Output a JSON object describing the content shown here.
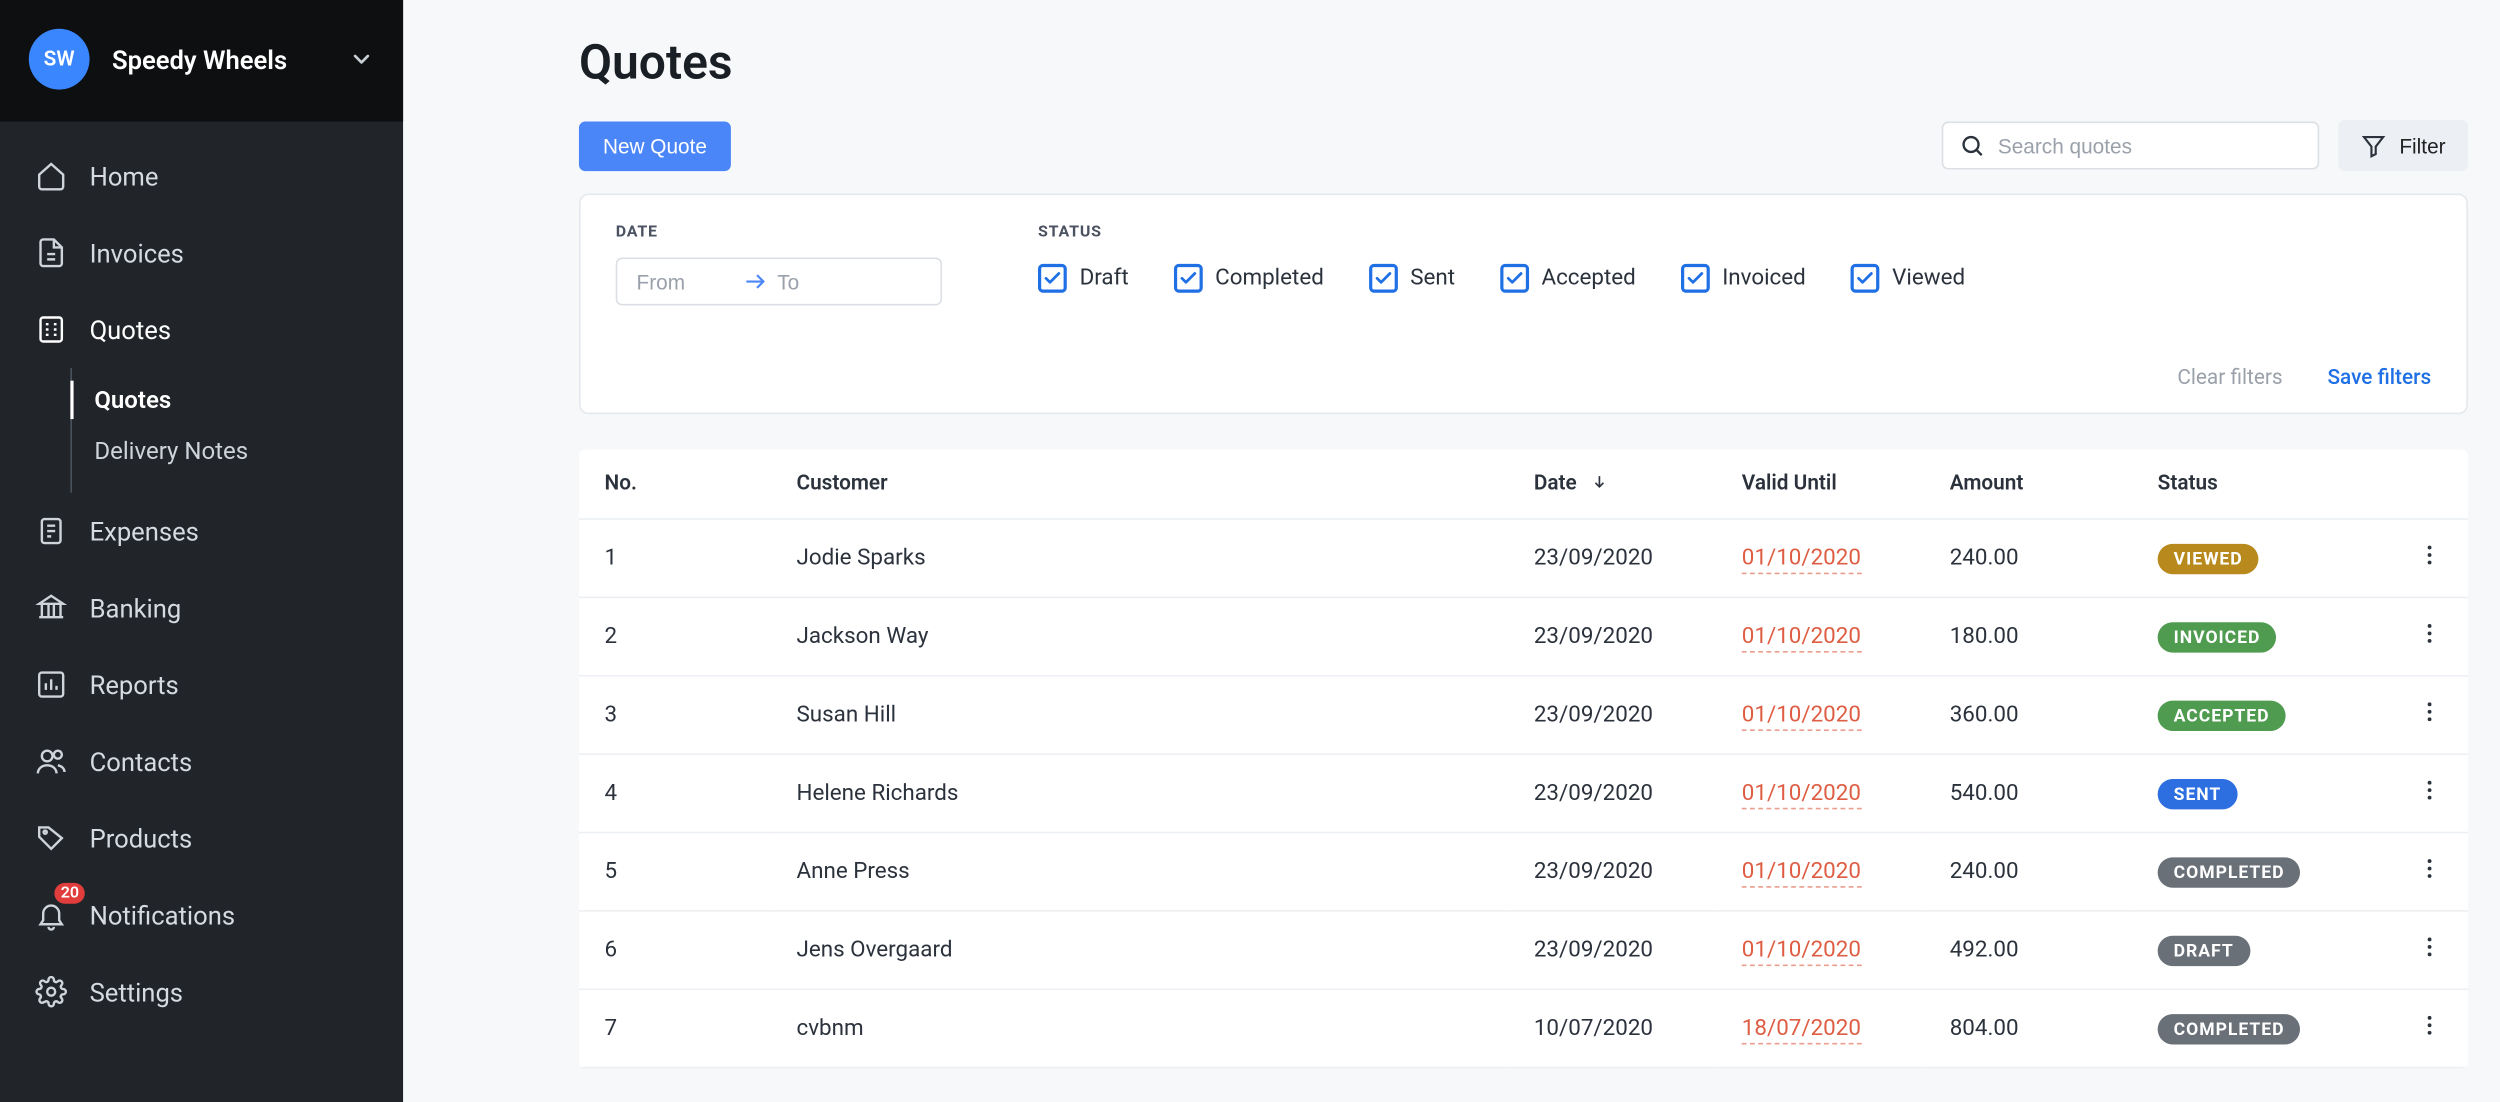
{
  "brand": {
    "initials": "SW",
    "name": "Speedy Wheels"
  },
  "nav": {
    "home": "Home",
    "invoices": "Invoices",
    "quotes": "Quotes",
    "sub_quotes": "Quotes",
    "sub_delivery": "Delivery Notes",
    "expenses": "Expenses",
    "banking": "Banking",
    "reports": "Reports",
    "contacts": "Contacts",
    "products": "Products",
    "notifications": "Notifications",
    "notifications_badge": "20",
    "settings": "Settings"
  },
  "page": {
    "title": "Quotes",
    "new_quote": "New Quote",
    "search_placeholder": "Search quotes",
    "filter_label": "Filter"
  },
  "filters": {
    "date_label": "DATE",
    "from_placeholder": "From",
    "to_placeholder": "To",
    "status_label": "STATUS",
    "statuses": {
      "draft": "Draft",
      "completed": "Completed",
      "sent": "Sent",
      "accepted": "Accepted",
      "invoiced": "Invoiced",
      "viewed": "Viewed"
    },
    "clear": "Clear filters",
    "save": "Save filters"
  },
  "table": {
    "headers": {
      "no": "No.",
      "customer": "Customer",
      "date": "Date",
      "valid_until": "Valid Until",
      "amount": "Amount",
      "status": "Status"
    },
    "rows": [
      {
        "no": "1",
        "customer": "Jodie Sparks",
        "date": "23/09/2020",
        "valid": "01/10/2020",
        "amount": "240.00",
        "status": "VIEWED",
        "style": "viewed"
      },
      {
        "no": "2",
        "customer": "Jackson Way",
        "date": "23/09/2020",
        "valid": "01/10/2020",
        "amount": "180.00",
        "status": "INVOICED",
        "style": "invoiced"
      },
      {
        "no": "3",
        "customer": "Susan Hill",
        "date": "23/09/2020",
        "valid": "01/10/2020",
        "amount": "360.00",
        "status": "ACCEPTED",
        "style": "accepted"
      },
      {
        "no": "4",
        "customer": "Helene Richards",
        "date": "23/09/2020",
        "valid": "01/10/2020",
        "amount": "540.00",
        "status": "SENT",
        "style": "sent"
      },
      {
        "no": "5",
        "customer": "Anne Press",
        "date": "23/09/2020",
        "valid": "01/10/2020",
        "amount": "240.00",
        "status": "COMPLETED",
        "style": "completed"
      },
      {
        "no": "6",
        "customer": "Jens Overgaard",
        "date": "23/09/2020",
        "valid": "01/10/2020",
        "amount": "492.00",
        "status": "DRAFT",
        "style": "draft"
      },
      {
        "no": "7",
        "customer": "cvbnm",
        "date": "10/07/2020",
        "valid": "18/07/2020",
        "amount": "804.00",
        "status": "COMPLETED",
        "style": "completed"
      }
    ]
  }
}
